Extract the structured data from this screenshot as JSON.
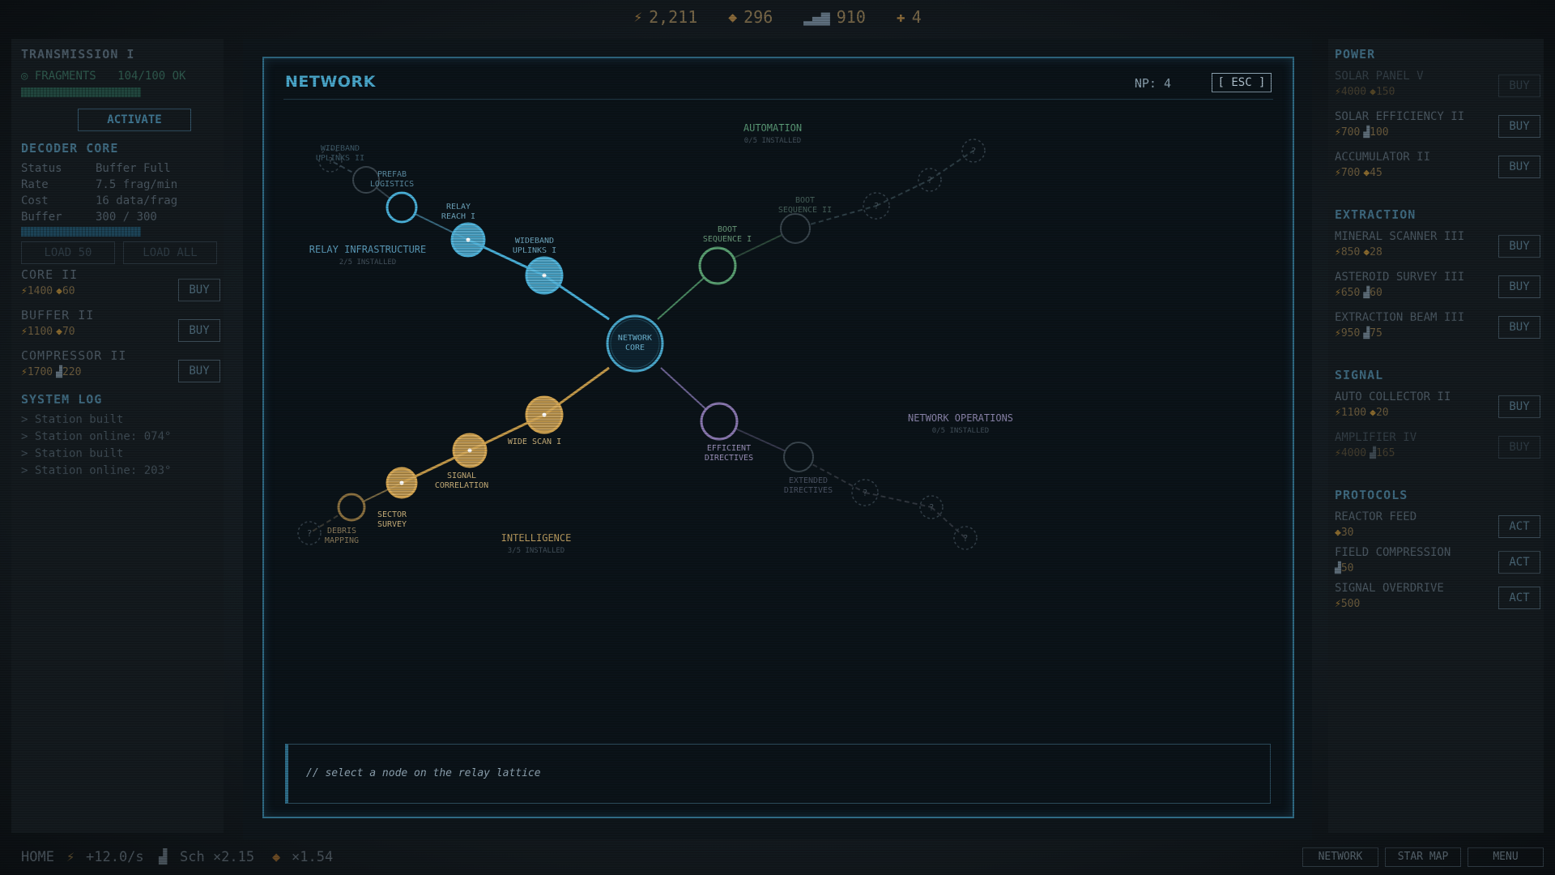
{
  "topbar": {
    "energy": "2,211",
    "minerals": "296",
    "signal": "910",
    "np": "4"
  },
  "left_panel": {
    "transmission_title": "TRANSMISSION I",
    "fragments_label": "FRAGMENTS",
    "fragments_value": "104/100 OK",
    "fragments_progress": 1.0,
    "activate_label": "ACTIVATE",
    "decoder_title": "DECODER CORE",
    "decoder_rows": [
      {
        "key": "Status",
        "value": "Buffer Full"
      },
      {
        "key": "Rate",
        "value": "7.5 frag/min"
      },
      {
        "key": "Cost",
        "value": "16 data/frag"
      },
      {
        "key": "Buffer",
        "value": "300 / 300"
      }
    ],
    "buffer_progress": 1.0,
    "load50_label": "LOAD 50",
    "loadall_label": "LOAD ALL",
    "upgrades": [
      {
        "name": "CORE II",
        "energy": "1400",
        "mineral": "60",
        "buy": "BUY"
      },
      {
        "name": "BUFFER II",
        "energy": "1100",
        "mineral": "70",
        "buy": "BUY"
      },
      {
        "name": "COMPRESSOR II",
        "energy": "1700",
        "signal": "220",
        "buy": "BUY"
      }
    ],
    "log_title": "SYSTEM LOG",
    "log": [
      "> Station built",
      "> Station online: 074°",
      "> Station built",
      "> Station online: 203°"
    ]
  },
  "modal": {
    "title": "NETWORK",
    "np_label": "NP: 4",
    "esc_label": "[ ESC ]",
    "console_text": "// select a node on the relay lattice",
    "sectors": {
      "relay": {
        "title": "RELAY INFRASTRUCTURE",
        "sub": "2/5 INSTALLED"
      },
      "automation": {
        "title": "AUTOMATION",
        "sub": "0/5 INSTALLED"
      },
      "intelligence": {
        "title": "INTELLIGENCE",
        "sub": "3/5 INSTALLED"
      },
      "operations": {
        "title": "NETWORK OPERATIONS",
        "sub": "0/5 INSTALLED"
      }
    },
    "core_label_1": "NETWORK",
    "core_label_2": "CORE",
    "unknown_mark": "?",
    "nodes": {
      "relay_reach": [
        "RELAY",
        "REACH I"
      ],
      "wideband1": [
        "WIDEBAND",
        "UPLINKS I"
      ],
      "prefab": [
        "PREFAB",
        "LOGISTICS"
      ],
      "wideband2": [
        "WIDEBAND",
        "UPLINKS II"
      ],
      "boot1": [
        "BOOT",
        "SEQUENCE I"
      ],
      "boot2": [
        "BOOT",
        "SEQUENCE II"
      ],
      "widescan": [
        "WIDE SCAN I"
      ],
      "signalcorr": [
        "SIGNAL",
        "CORRELATION"
      ],
      "sector": [
        "SECTOR",
        "SURVEY"
      ],
      "debris": [
        "DEBRIS",
        "MAPPING"
      ],
      "efficient": [
        "EFFICIENT",
        "DIRECTIVES"
      ],
      "extended": [
        "EXTENDED",
        "DIRECTIVES"
      ]
    },
    "colors": {
      "relay": "#4ab0d8",
      "automation": "#5aa072",
      "intelligence": "#d4a550",
      "operations": "#8a78b0"
    }
  },
  "right_panel": {
    "groups": [
      {
        "title": "POWER",
        "items": [
          {
            "name": "SOLAR PANEL V",
            "c1": "4000",
            "t1": "e",
            "c2": "150",
            "t2": "m",
            "btn": "BUY",
            "enabled": false
          },
          {
            "name": "SOLAR EFFICIENCY II",
            "c1": "700",
            "t1": "e",
            "c2": "100",
            "t2": "s",
            "btn": "BUY",
            "enabled": true
          },
          {
            "name": "ACCUMULATOR II",
            "c1": "700",
            "t1": "e",
            "c2": "45",
            "t2": "m",
            "btn": "BUY",
            "enabled": true
          }
        ]
      },
      {
        "title": "EXTRACTION",
        "items": [
          {
            "name": "MINERAL SCANNER III",
            "c1": "850",
            "t1": "e",
            "c2": "28",
            "t2": "m",
            "btn": "BUY",
            "enabled": true
          },
          {
            "name": "ASTEROID SURVEY III",
            "c1": "650",
            "t1": "e",
            "c2": "60",
            "t2": "s",
            "btn": "BUY",
            "enabled": true
          },
          {
            "name": "EXTRACTION BEAM III",
            "c1": "950",
            "t1": "e",
            "c2": "75",
            "t2": "s",
            "btn": "BUY",
            "enabled": true
          }
        ]
      },
      {
        "title": "SIGNAL",
        "items": [
          {
            "name": "AUTO COLLECTOR II",
            "c1": "1100",
            "t1": "e",
            "c2": "20",
            "t2": "m",
            "btn": "BUY",
            "enabled": true
          },
          {
            "name": "AMPLIFIER IV",
            "c1": "4000",
            "t1": "e",
            "c2": "165",
            "t2": "s",
            "btn": "BUY",
            "enabled": false
          }
        ]
      },
      {
        "title": "PROTOCOLS",
        "items": [
          {
            "name": "REACTOR FEED",
            "c1": "30",
            "t1": "m",
            "btn": "ACT",
            "enabled": true
          },
          {
            "name": "FIELD COMPRESSION",
            "c1": "50",
            "t1": "s",
            "btn": "ACT",
            "enabled": true
          },
          {
            "name": "SIGNAL OVERDRIVE",
            "c1": "500",
            "t1": "e",
            "btn": "ACT",
            "enabled": true
          }
        ]
      }
    ]
  },
  "bottombar": {
    "home": "HOME",
    "rate": "+12.0/s",
    "sch": "Sch ×2.15",
    "mult": "×1.54",
    "nav": [
      "NETWORK",
      "STAR MAP",
      "MENU"
    ]
  }
}
